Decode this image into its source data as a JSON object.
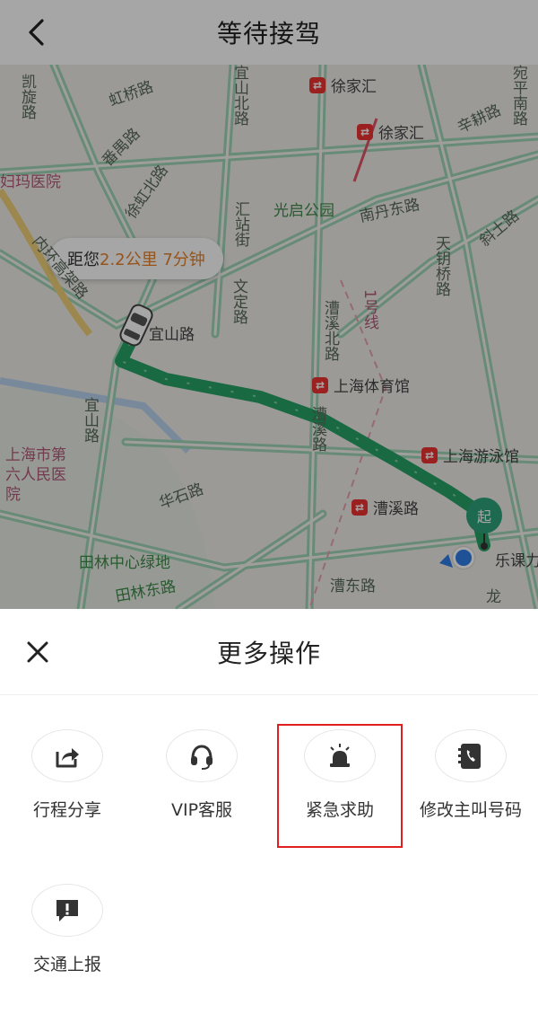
{
  "header": {
    "title": "等待接驾",
    "back_icon": "chevron-left-icon"
  },
  "map": {
    "eta_prefix": "距您",
    "eta_distance": "2.2公里 7分钟",
    "start_marker": "起",
    "labels": {
      "hongqiao_rd": "虹桥路",
      "kaixuan_rd": "凯旋路",
      "fanyu_rd": "番禺路",
      "xuhong_n_rd": "徐虹北路",
      "yishan_n_rd": "宜山北路",
      "yishan_rd": "宜山路",
      "yishan_rd2": "宜山路",
      "inner_ring": "内环高架路",
      "huizhan": "汇站街",
      "wending_rd": "文定路",
      "guangqi_park": "光启公园",
      "nandan_e_rd": "南丹东路",
      "caoxi_n_rd": "漕溪北路",
      "caoxi_rd": "漕溪路",
      "xuhui_station1": "徐家汇",
      "xuhui_station2": "徐家汇",
      "stadium": "上海体育馆",
      "natatorium": "上海游泳馆",
      "caoxi_station": "漕溪路",
      "tianyaoqiao": "天钥桥路",
      "xietu_rd": "斜土路",
      "xingjin_rd": "辛耕路",
      "yunping_rd": "宛平南路",
      "huashi_rd": "华石路",
      "tianlin_park": "田林中心绿地",
      "tianlin_e_rd": "田林东路",
      "caodong_rd": "漕东路",
      "hospital6": "上海市第六人民医院",
      "renji": "妇玛医院",
      "lekeda": "乐课力",
      "line1": "1号线",
      "long": "龙"
    }
  },
  "sheet": {
    "title": "更多操作",
    "actions": [
      {
        "label": "行程分享",
        "icon": "share-icon"
      },
      {
        "label": "VIP客服",
        "icon": "headset-icon"
      },
      {
        "label": "紧急求助",
        "icon": "alarm-icon"
      },
      {
        "label": "修改主叫号码",
        "icon": "phone-book-icon"
      },
      {
        "label": "交通上报",
        "icon": "report-icon"
      }
    ]
  }
}
